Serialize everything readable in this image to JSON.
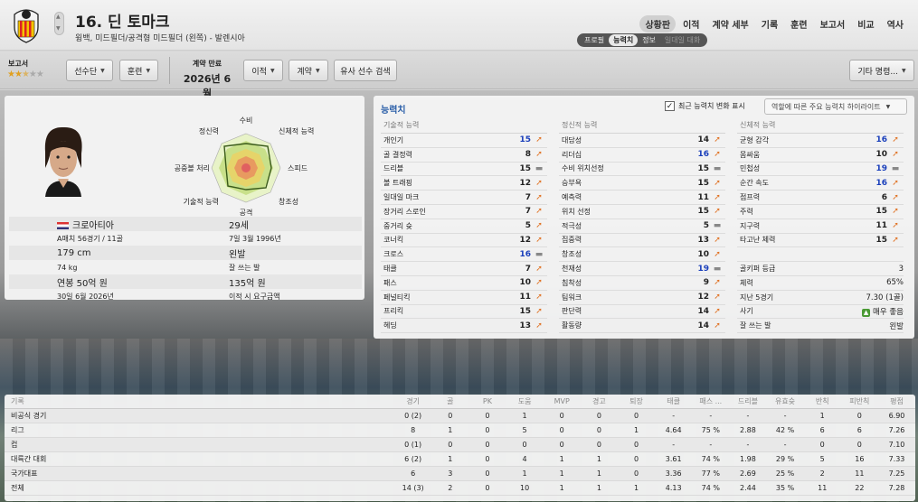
{
  "header": {
    "player_name": "16. 딘 토마크",
    "subtitle": "윙백, 미드필더/공격형 미드필더 (왼쪽) - 발렌시아",
    "nav": [
      "상황판",
      "이적",
      "계약 세부",
      "기록",
      "훈련",
      "보고서",
      "비교",
      "역사"
    ],
    "nav_active": 0,
    "subtabs": [
      "프로필",
      "능력치",
      "정보",
      "일대일 대화"
    ],
    "subtabs_active": 1
  },
  "toolbar": {
    "reputation_label": "보고서",
    "stars": 2.5,
    "squad_button": "선수단",
    "training_button": "훈련",
    "contract_label": "계약 만료",
    "contract_value": "2026년 6월",
    "transfer_button": "이적",
    "contract_button": "계약",
    "similar_button": "유사 선수 검색",
    "other_button": "기타 명령..."
  },
  "radar_labels": {
    "top": "수비",
    "tr": "신체적 능력",
    "r": "스피드",
    "br": "창조성",
    "b": "공격",
    "bl": "기술적 능력",
    "l": "공중볼 처리",
    "tl": "정신력"
  },
  "bio": {
    "nationality": "크로아티아",
    "age": "29세",
    "caps": "A매치 56경기 / 11골",
    "birth": "7일 3월 1996년",
    "height": "179 cm",
    "foot": "왼발",
    "weight": "74 kg",
    "foot_label": "잘 쓰는 발",
    "salary": "연봉 50억 원",
    "value": "135억 원",
    "contract_end": "30일 6월 2026년",
    "transfer_req": "이적 시 요구금액"
  },
  "attributes": {
    "title": "능력치",
    "recent_label": "최근 능력치 변화 표시",
    "role_select": "역할에 따른 주요 능력치 하이라이트",
    "technical": {
      "header": "기술적 능력",
      "items": [
        {
          "name": "개인기",
          "value": "15",
          "trend": "up",
          "hl": true
        },
        {
          "name": "골 결정력",
          "value": "8",
          "trend": "up",
          "hl": false
        },
        {
          "name": "드리블",
          "value": "15",
          "trend": "flat",
          "hl": false
        },
        {
          "name": "볼 트래핑",
          "value": "12",
          "trend": "up",
          "hl": false
        },
        {
          "name": "일대일 마크",
          "value": "7",
          "trend": "up",
          "hl": false
        },
        {
          "name": "장거리 스로인",
          "value": "7",
          "trend": "up",
          "hl": false
        },
        {
          "name": "중거리 슛",
          "value": "5",
          "trend": "up",
          "hl": false
        },
        {
          "name": "코너킥",
          "value": "12",
          "trend": "up",
          "hl": false
        },
        {
          "name": "크로스",
          "value": "16",
          "trend": "flat",
          "hl": true
        },
        {
          "name": "태클",
          "value": "7",
          "trend": "up",
          "hl": false
        },
        {
          "name": "패스",
          "value": "10",
          "trend": "up",
          "hl": false
        },
        {
          "name": "페널티킥",
          "value": "11",
          "trend": "up",
          "hl": false
        },
        {
          "name": "프리킥",
          "value": "15",
          "trend": "up",
          "hl": false
        },
        {
          "name": "헤딩",
          "value": "13",
          "trend": "up",
          "hl": false
        }
      ]
    },
    "mental": {
      "header": "정신적 능력",
      "items": [
        {
          "name": "대담성",
          "value": "14",
          "trend": "up",
          "hl": false
        },
        {
          "name": "리더십",
          "value": "16",
          "trend": "up",
          "hl": true
        },
        {
          "name": "수비 위치선정",
          "value": "15",
          "trend": "flat",
          "hl": false
        },
        {
          "name": "승부욕",
          "value": "15",
          "trend": "up",
          "hl": false
        },
        {
          "name": "예측력",
          "value": "11",
          "trend": "up",
          "hl": false
        },
        {
          "name": "위치 선정",
          "value": "15",
          "trend": "up",
          "hl": false
        },
        {
          "name": "적극성",
          "value": "5",
          "trend": "flat",
          "hl": false
        },
        {
          "name": "집중력",
          "value": "13",
          "trend": "up",
          "hl": false
        },
        {
          "name": "창조성",
          "value": "10",
          "trend": "up",
          "hl": false
        },
        {
          "name": "천재성",
          "value": "19",
          "trend": "flat",
          "hl": true
        },
        {
          "name": "침착성",
          "value": "9",
          "trend": "up",
          "hl": false
        },
        {
          "name": "팀워크",
          "value": "12",
          "trend": "up",
          "hl": false
        },
        {
          "name": "판단력",
          "value": "14",
          "trend": "up",
          "hl": false
        },
        {
          "name": "활동량",
          "value": "14",
          "trend": "up",
          "hl": false
        }
      ]
    },
    "physical": {
      "header": "신체적 능력",
      "items": [
        {
          "name": "균형 감각",
          "value": "16",
          "trend": "up",
          "hl": true
        },
        {
          "name": "몸싸움",
          "value": "10",
          "trend": "up",
          "hl": false
        },
        {
          "name": "민첩성",
          "value": "19",
          "trend": "flat",
          "hl": true
        },
        {
          "name": "순간 속도",
          "value": "16",
          "trend": "up",
          "hl": true
        },
        {
          "name": "점프력",
          "value": "6",
          "trend": "up",
          "hl": false
        },
        {
          "name": "주력",
          "value": "15",
          "trend": "up",
          "hl": false
        },
        {
          "name": "지구력",
          "value": "11",
          "trend": "up",
          "hl": false
        },
        {
          "name": "타고난 체력",
          "value": "15",
          "trend": "up",
          "hl": false
        }
      ]
    },
    "extra": [
      {
        "name": "골키퍼 등급",
        "value": "3"
      },
      {
        "name": "체력",
        "value": "65%"
      },
      {
        "name": "지난 5경기",
        "value": "7.30 (1골)"
      },
      {
        "name": "사기",
        "value": "매우 좋음"
      },
      {
        "name": "잘 쓰는 발",
        "value": "왼발"
      }
    ]
  },
  "stats": {
    "headers": [
      "기록",
      "경기",
      "골",
      "PK",
      "도움",
      "MVP",
      "경고",
      "퇴장",
      "태클",
      "패스 ...",
      "드리블",
      "유효슛",
      "반칙",
      "피반칙",
      "평점"
    ],
    "rows": [
      [
        "비공식 경기",
        "0 (2)",
        "0",
        "0",
        "1",
        "0",
        "0",
        "0",
        "-",
        "-",
        "-",
        "-",
        "1",
        "0",
        "6.90"
      ],
      [
        "리그",
        "8",
        "1",
        "0",
        "5",
        "0",
        "0",
        "1",
        "4.64",
        "75 %",
        "2.88",
        "42 %",
        "6",
        "6",
        "7.26"
      ],
      [
        "컵",
        "0 (1)",
        "0",
        "0",
        "0",
        "0",
        "0",
        "0",
        "-",
        "-",
        "-",
        "-",
        "0",
        "0",
        "7.10"
      ],
      [
        "대륙간 대회",
        "6 (2)",
        "1",
        "0",
        "4",
        "1",
        "1",
        "0",
        "3.61",
        "74 %",
        "1.98",
        "29 %",
        "5",
        "16",
        "7.33"
      ],
      [
        "국가대표",
        "6",
        "3",
        "0",
        "1",
        "1",
        "1",
        "0",
        "3.36",
        "77 %",
        "2.69",
        "25 %",
        "2",
        "11",
        "7.25"
      ],
      [
        "전체",
        "14 (3)",
        "2",
        "0",
        "10",
        "1",
        "1",
        "1",
        "4.13",
        "74 %",
        "2.44",
        "35 %",
        "11",
        "22",
        "7.28"
      ]
    ]
  }
}
